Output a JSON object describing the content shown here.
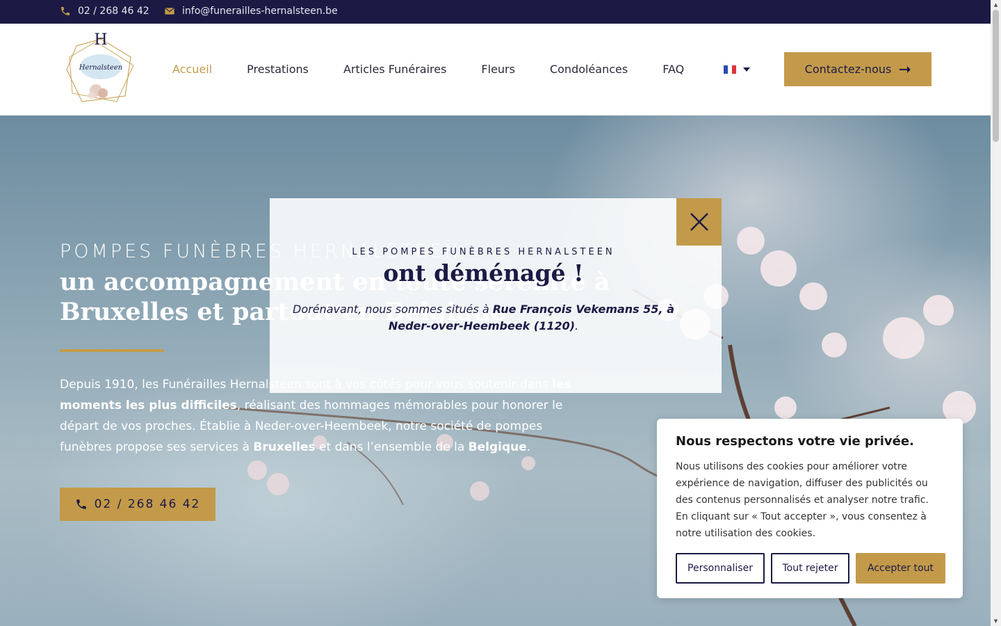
{
  "topbar": {
    "phone": "02 / 268 46 42",
    "email": "info@funerailles-hernalsteen.be",
    "icons": {
      "phone": "phone-icon",
      "email": "envelope-icon"
    }
  },
  "header": {
    "logo_letter": "H",
    "logo_name": "Hernalsteen",
    "nav": [
      {
        "label": "Accueil",
        "active": true
      },
      {
        "label": "Prestations",
        "active": false
      },
      {
        "label": "Articles Funéraires",
        "active": false
      },
      {
        "label": "Fleurs",
        "active": false
      },
      {
        "label": "Condoléances",
        "active": false
      },
      {
        "label": "FAQ",
        "active": false
      }
    ],
    "language": "fr",
    "cta_label": "Contactez-nous"
  },
  "hero": {
    "sup": "POMPES FUNÈBRES HERNALSTEEN",
    "title_line1": "un accompagnement en toute sérénité à",
    "title_line2": "Bruxelles et partout en Belgique",
    "text_parts": [
      "Depuis 1910, les Funérailles Hernalsteen sont à vos côtés pour vous soutenir dans ",
      "les moments les plus difficiles",
      ", réalisant des hommages mémorables pour honorer le départ de vos proches. Établie à Neder-over-Heembeek, notre société de pompes funèbres propose ses services à ",
      "Bruxelles",
      " et dans l’ensemble de la ",
      "Belgique",
      "."
    ],
    "button_label": "02 / 268 46 42"
  },
  "modal": {
    "sup": "LES POMPES FUNÈBRES HERNALSTEEN",
    "title": "ont déménagé !",
    "text_prefix": "Dorénavant, nous sommes situés à ",
    "text_bold": "Rue François Vekemans 55, à Neder-over-Heembeek (1120)",
    "text_suffix": "."
  },
  "cookie": {
    "title": "Nous respectons votre vie privée.",
    "text": "Nous utilisons des cookies pour améliorer votre expérience de navigation, diffuser des publicités ou des contenus personnalisés et analyser notre trafic. En cliquant sur « Tout accepter », vous consentez à notre utilisation des cookies.",
    "btn_customize": "Personnaliser",
    "btn_reject": "Tout rejeter",
    "btn_accept": "Accepter tout"
  },
  "colors": {
    "navy": "#1c1a45",
    "gold": "#c39a4a"
  }
}
